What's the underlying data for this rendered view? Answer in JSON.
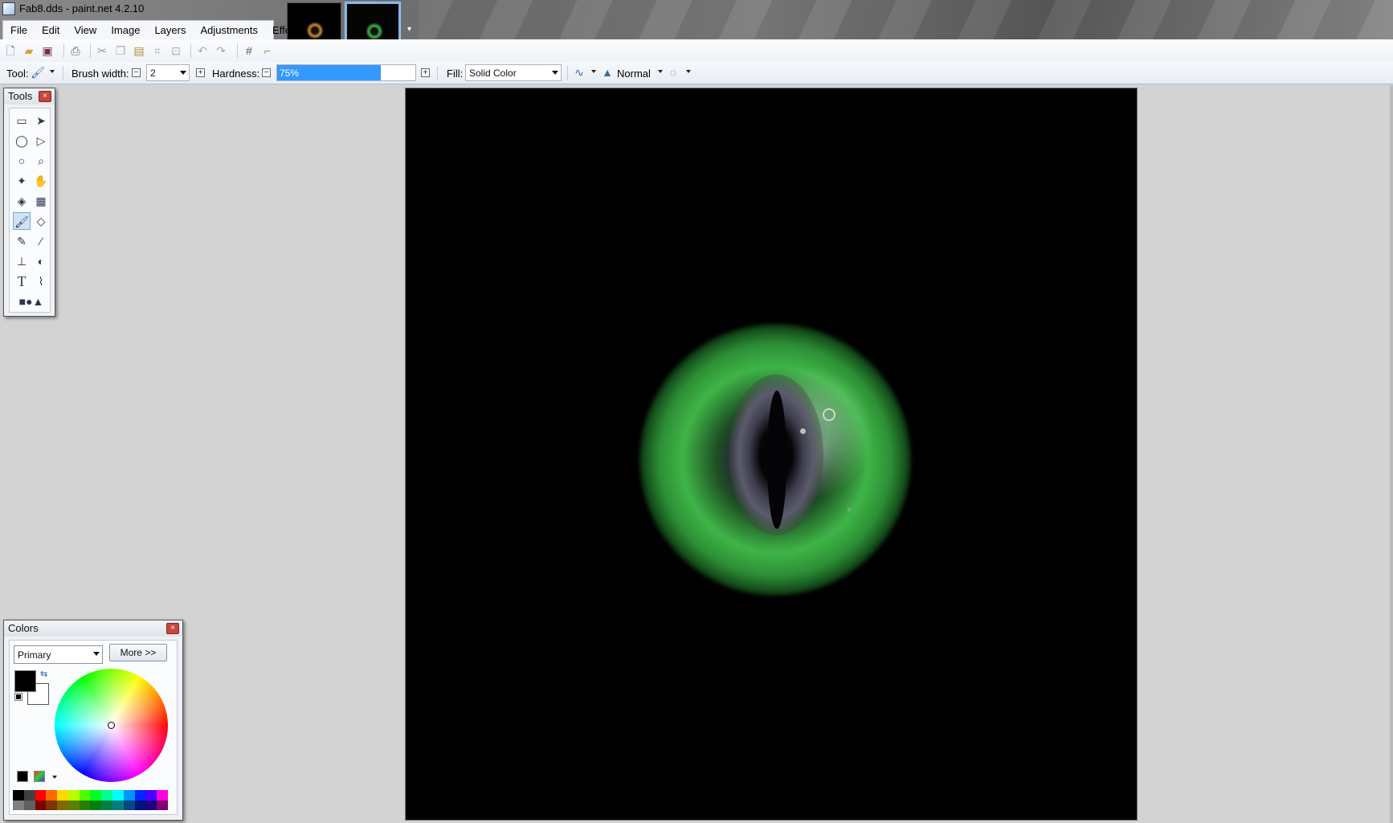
{
  "window": {
    "title": "Fab8.dds - paint.net 4.2.10"
  },
  "menu": [
    "File",
    "Edit",
    "View",
    "Image",
    "Layers",
    "Adjustments",
    "Effects"
  ],
  "toolbar": {
    "tool_label": "Tool:",
    "brush_width_label": "Brush width:",
    "brush_width_value": "2",
    "hardness_label": "Hardness:",
    "hardness_value": "75%",
    "hardness_level": 0.75,
    "fill_label": "Fill:",
    "fill_value": "Solid Color",
    "blend_mode": "Normal"
  },
  "tools_panel": {
    "title": "Tools"
  },
  "colors_panel": {
    "title": "Colors",
    "selector_value": "Primary",
    "more_button": "More >>",
    "primary_color": "#000000",
    "secondary_color": "#ffffff",
    "palette_top": [
      "#000000",
      "#404040",
      "#ff0000",
      "#ff6a00",
      "#ffd800",
      "#b6ff00",
      "#4cff00",
      "#00ff21",
      "#00ff90",
      "#00ffff",
      "#0094ff",
      "#0026ff",
      "#4800ff",
      "#ff00dc"
    ],
    "palette_bottom": [
      "#808080",
      "#606060",
      "#7f0000",
      "#7f3300",
      "#7f6a00",
      "#5b7f00",
      "#267f00",
      "#007f0e",
      "#007f46",
      "#007f7f",
      "#004a7f",
      "#00137f",
      "#21007f",
      "#7f006e"
    ]
  },
  "accent": "#3399ff"
}
